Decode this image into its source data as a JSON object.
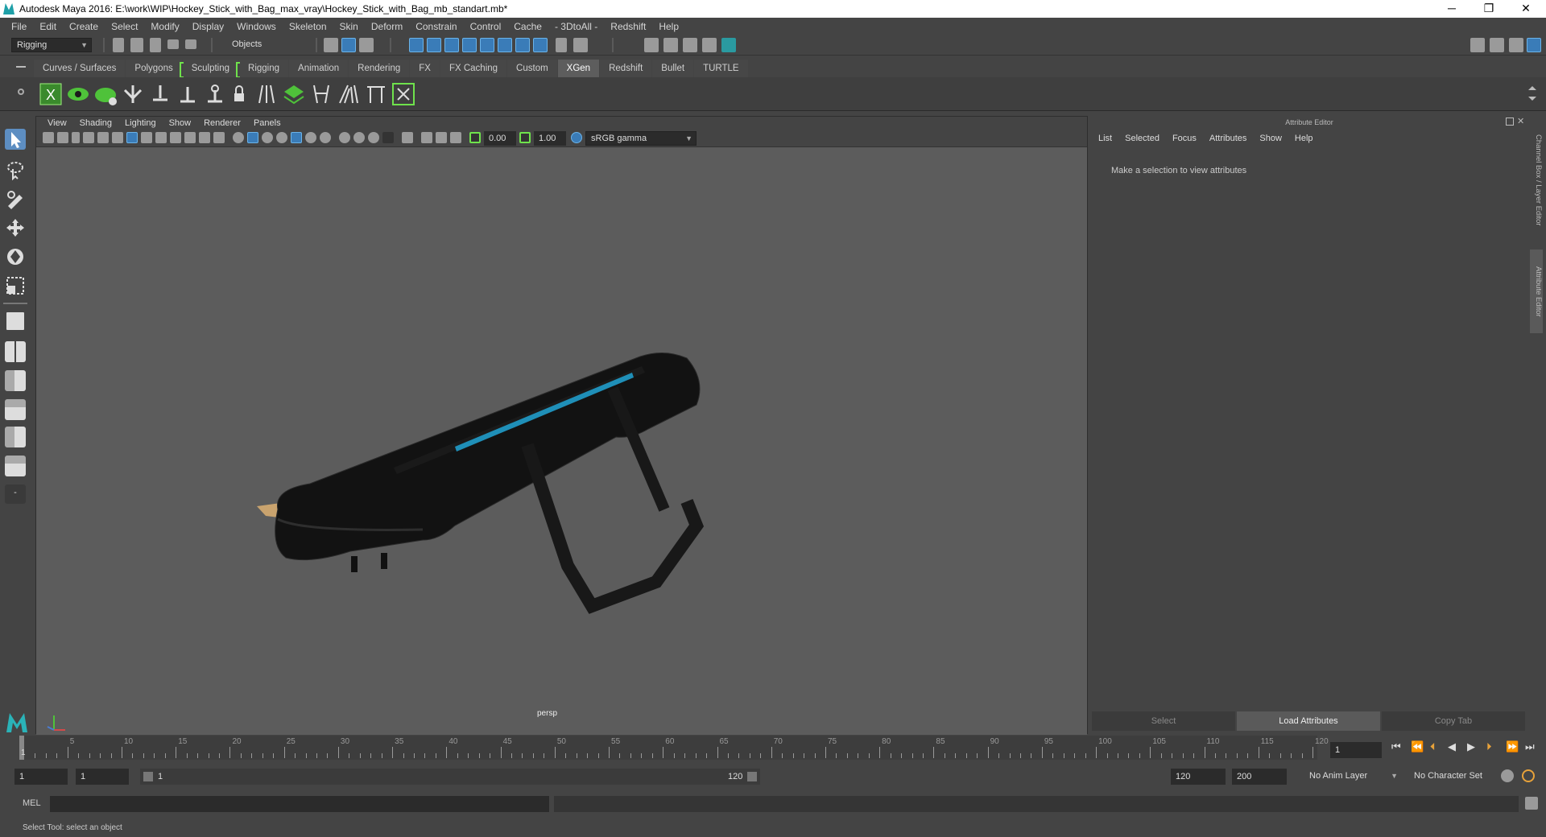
{
  "window": {
    "title": "Autodesk Maya 2016: E:\\work\\WIP\\Hockey_Stick_with_Bag_max_vray\\Hockey_Stick_with_Bag_mb_standart.mb*",
    "min": "─",
    "max": "❐",
    "close": "✕"
  },
  "menubar": [
    "File",
    "Edit",
    "Create",
    "Select",
    "Modify",
    "Display",
    "Windows",
    "Skeleton",
    "Skin",
    "Deform",
    "Constrain",
    "Control",
    "Cache",
    "- 3DtoAll -",
    "Redshift",
    "Help"
  ],
  "statusline": {
    "mode": "Rigging",
    "selection_mode": "Objects"
  },
  "shelf": {
    "tabs": [
      "Curves / Surfaces",
      "Polygons",
      "Sculpting",
      "Rigging",
      "Animation",
      "Rendering",
      "FX",
      "FX Caching",
      "Custom",
      "XGen",
      "Redshift",
      "Bullet",
      "TURTLE"
    ],
    "active_tab": "XGen"
  },
  "viewport": {
    "menu": [
      "View",
      "Shading",
      "Lighting",
      "Show",
      "Renderer",
      "Panels"
    ],
    "exposure": "0.00",
    "gamma": "1.00",
    "color_space": "sRGB gamma",
    "camera_label": "persp"
  },
  "attribute_editor": {
    "title": "Attribute Editor",
    "menu": [
      "List",
      "Selected",
      "Focus",
      "Attributes",
      "Show",
      "Help"
    ],
    "message": "Make a selection to view attributes",
    "buttons": {
      "select": "Select",
      "load": "Load Attributes",
      "copy": "Copy Tab"
    }
  },
  "side_tabs": {
    "channel_box": "Channel Box / Layer Editor",
    "attribute_editor": "Attribute Editor"
  },
  "timeline": {
    "ticks": [
      "5",
      "10",
      "15",
      "20",
      "25",
      "30",
      "35",
      "40",
      "45",
      "50",
      "55",
      "60",
      "65",
      "70",
      "75",
      "80",
      "85",
      "90",
      "95",
      "100",
      "105",
      "110",
      "115",
      "120"
    ],
    "current_frame_marker": "1",
    "current_frame": "1"
  },
  "range": {
    "start": "1",
    "playback_start": "1",
    "slider_start": "1",
    "slider_end": "120",
    "playback_end": "120",
    "end": "200",
    "anim_layer": "No Anim Layer",
    "character_set": "No Character Set"
  },
  "command": {
    "label": "MEL"
  },
  "help_line": "Select Tool: select an object"
}
